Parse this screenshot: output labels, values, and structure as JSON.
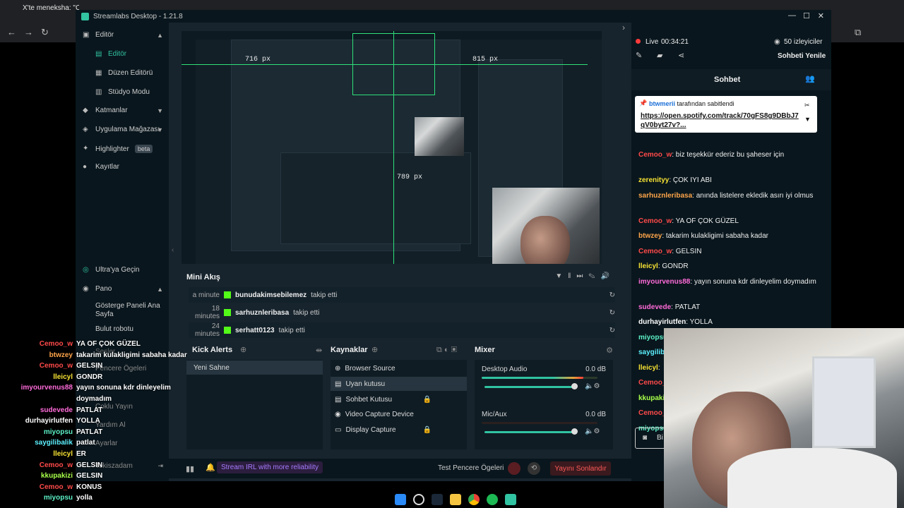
{
  "browser": {
    "tab1": "X'te meneksheP",
    "tab_title": "X'te meneksha: \"C",
    "url_fragment": "X"
  },
  "app": {
    "title": "Streamlabs Desktop - 1.21.8",
    "brand_color": "#31c3a2"
  },
  "sidebar": {
    "editor_group": "Editör",
    "items": [
      {
        "label": "Editör",
        "icon": "editor-icon"
      },
      {
        "label": "Düzen Editörü",
        "icon": "layout-icon"
      },
      {
        "label": "Stüdyo Modu",
        "icon": "studio-icon"
      }
    ],
    "layers": "Katmanlar",
    "app_store": "Uygulama Mağazası",
    "highlighter": "Highlighter",
    "highlighter_badge": "beta",
    "recordings": "Kayıtlar",
    "ultra": "Ultra'ya Geçin",
    "dashboard": "Pano",
    "dashboard_items": [
      "Gösterge Paneli Ana Sayfa",
      "Bulut robotu",
      "Sesler",
      "Pencere Ögeleri",
      "Çoklu Yayın",
      "Yardım Al",
      "Ayarlar",
      "Tekiszadam"
    ]
  },
  "preview": {
    "dim_left": "716 px",
    "dim_right": "815 px",
    "dim_bottom": "789 px"
  },
  "mini_feed": {
    "title": "Mini Akış",
    "rows": [
      {
        "time": "a minute",
        "name": "bunudakimsebilemez",
        "action": "takip etti"
      },
      {
        "time": "18 minutes",
        "name": "sarhuznleribasa",
        "action": "takip etti"
      },
      {
        "time": "24 minutes",
        "name": "serhatt0123",
        "action": "takip etti"
      }
    ]
  },
  "scenes": {
    "title": "Kick Alerts",
    "items": [
      "Yeni Sahne"
    ]
  },
  "sources": {
    "title": "Kaynaklar",
    "items": [
      {
        "label": "Browser Source",
        "selected": false
      },
      {
        "label": "Uyan kutusu",
        "selected": true
      },
      {
        "label": "Sohbet Kutusu",
        "selected": false
      },
      {
        "label": "Video Capture Device",
        "selected": false
      },
      {
        "label": "Display Capture",
        "selected": false
      }
    ]
  },
  "mixer": {
    "title": "Mixer",
    "channels": [
      {
        "name": "Desktop Audio",
        "db": "0.0 dB",
        "level": 0.88
      },
      {
        "name": "Mic/Aux",
        "db": "0.0 dB",
        "level": 0.0
      }
    ]
  },
  "footer": {
    "promo": "Stream IRL with more reliability",
    "test_widgets": "Test Pencere Ögeleri",
    "end_stream": "Yayını Sonlandır"
  },
  "live": {
    "status": "Live",
    "time": "00:34:21",
    "viewers": "50 izleyiciler",
    "refresh_chat": "Sohbeti Yenile"
  },
  "chat": {
    "title": "Sohbet",
    "pinned_by": "btwmerii",
    "pinned_suffix": "tarafından sabitlendi",
    "pinned_link": "https://open.spotify.com/track/70gFS8g9DBbJ7qV0byt27v?...",
    "messages": [
      {
        "user": "Cemoo_w",
        "color": "#ff4a4a",
        "text": "biz teşekkür ederiz bu şaheser için"
      },
      {
        "user": "zerenityy",
        "color": "#f7e233",
        "text": "ÇOK IYI ABI"
      },
      {
        "user": "sarhuznleribasa",
        "color": "#ffa54a",
        "text": "anında listelere ekledik asırı iyi olmus"
      },
      {
        "user": "Cemoo_w",
        "color": "#ff4a4a",
        "text": "YA OF ÇOK GÜZEL"
      },
      {
        "user": "btwzey",
        "color": "#ffa54a",
        "text": "takarim kulakligimi sabaha kadar"
      },
      {
        "user": "Cemoo_w",
        "color": "#ff4a4a",
        "text": "GELSIN"
      },
      {
        "user": "lleicyl",
        "color": "#f7e233",
        "text": "GONDR"
      },
      {
        "user": "imyourvenus88",
        "color": "#ff6bd9",
        "text": "yayın sonuna kdr dinleyelim doymadım"
      },
      {
        "user": "sudevede",
        "color": "#ff6bd9",
        "text": "PATLAT"
      },
      {
        "user": "durhayirlutfen",
        "color": "#ffffff",
        "text": "YOLLA"
      },
      {
        "user": "miyopsu",
        "color": "#5cf0c6",
        "text": "PATLAT"
      },
      {
        "user": "saygilibalik",
        "color": "#5cf0ff",
        "text": "patlat"
      },
      {
        "user": "lleicyl",
        "color": "#f7e233",
        "text": ""
      },
      {
        "user": "Cemoo_",
        "color": "#ff4a4a",
        "text": ""
      },
      {
        "user": "kkupaki",
        "color": "#a8ff4a",
        "text": ""
      },
      {
        "user": "Cemoo_",
        "color": "#ff4a4a",
        "text": ""
      },
      {
        "user": "miyopsu",
        "color": "#5cf0c6",
        "text": ""
      }
    ],
    "input_placeholder": "Bi"
  },
  "overlay_chat": [
    {
      "user": "Cemoo_w",
      "color": "#ff4a4a",
      "text": "YA OF ÇOK GÜZEL"
    },
    {
      "user": "btwzey",
      "color": "#ffa54a",
      "text": "takarim kulakligimi sabaha kadar"
    },
    {
      "user": "Cemoo_w",
      "color": "#ff4a4a",
      "text": "GELSIN"
    },
    {
      "user": "lleicyl",
      "color": "#f7e233",
      "text": "GONDR"
    },
    {
      "user": "imyourvenus88",
      "color": "#ff6bd9",
      "text": "yayın sonuna kdr dinleyelim"
    },
    {
      "user": "",
      "color": "#ffffff",
      "text": "doymadım"
    },
    {
      "user": "sudevede",
      "color": "#ff6bd9",
      "text": "PATLAT"
    },
    {
      "user": "durhayirlutfen",
      "color": "#ffffff",
      "text": "YOLLA"
    },
    {
      "user": "miyopsu",
      "color": "#5cf0c6",
      "text": "PATLAT"
    },
    {
      "user": "saygilibalik",
      "color": "#5cf0ff",
      "text": "patlat"
    },
    {
      "user": "lleicyl",
      "color": "#f7e233",
      "text": "ER"
    },
    {
      "user": "Cemoo_w",
      "color": "#ff4a4a",
      "text": "GELSIN"
    },
    {
      "user": "kkupakizi",
      "color": "#a8ff4a",
      "text": "GELSIN"
    },
    {
      "user": "Cemoo_w",
      "color": "#ff4a4a",
      "text": "KONUS"
    },
    {
      "user": "miyopsu",
      "color": "#5cf0c6",
      "text": "yolla"
    }
  ]
}
